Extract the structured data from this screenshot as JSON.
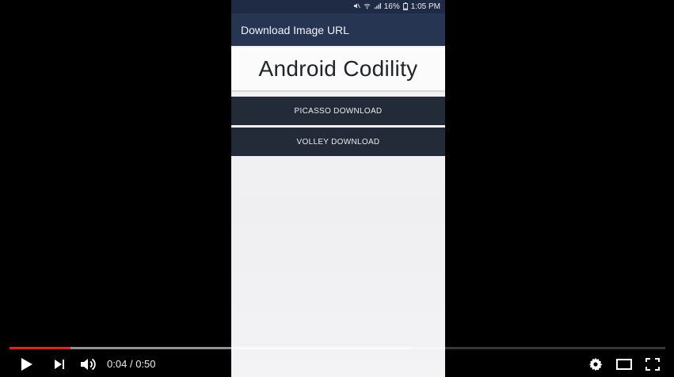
{
  "phone": {
    "status": {
      "battery": "16%",
      "time": "1:05 PM"
    },
    "app_bar_title": "Download Image URL",
    "content_title": "Android Codility",
    "buttons": {
      "picasso": "PICASSO DOWNLOAD",
      "volley": "VOLLEY DOWNLOAD"
    }
  },
  "player": {
    "current_time": "0:04",
    "separator": "/",
    "duration": "0:50",
    "played_fraction": 0.093,
    "buffered_fraction": 0.614,
    "accent_color": "#e62117",
    "icons": {
      "play": "play-icon",
      "next": "next-icon",
      "volume": "volume-icon",
      "settings": "settings-icon",
      "theater": "theater-mode-icon",
      "fullscreen": "fullscreen-icon"
    }
  }
}
